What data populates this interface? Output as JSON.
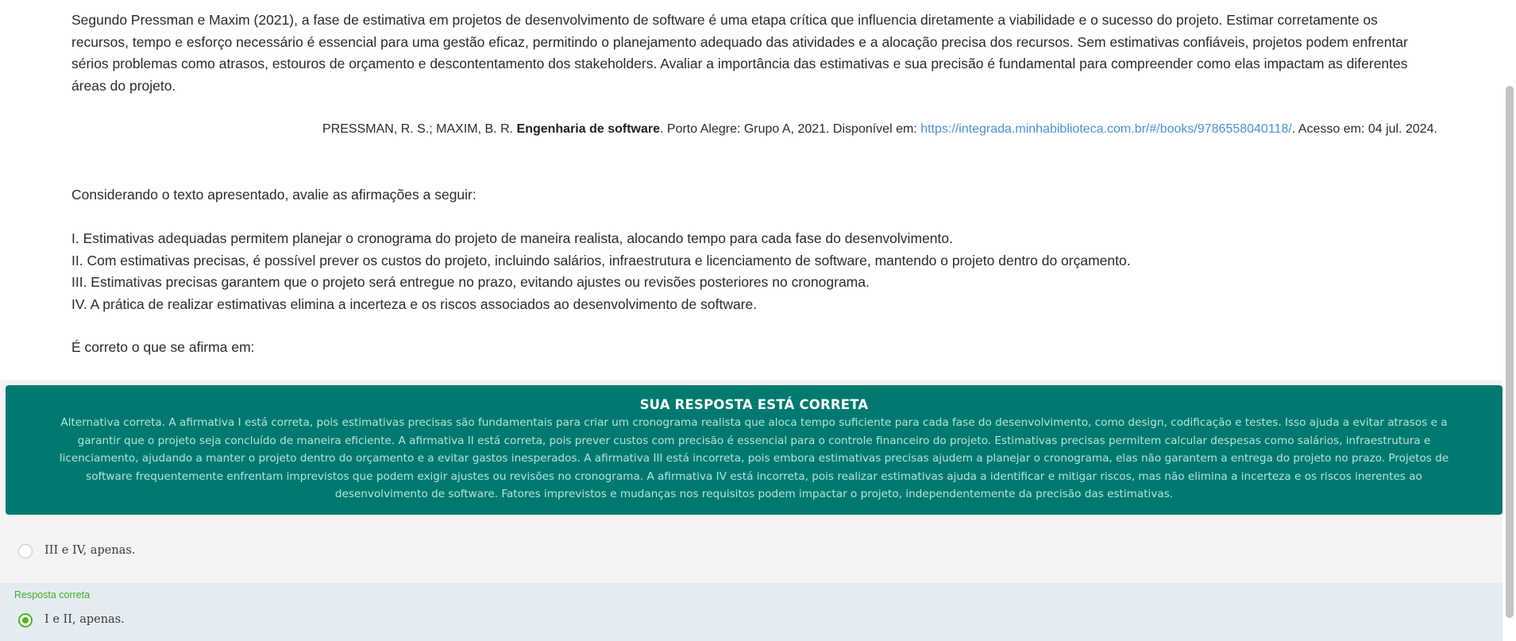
{
  "question": {
    "paragraph": "Segundo Pressman e Maxim (2021), a fase de estimativa em projetos de desenvolvimento de software é uma etapa crítica que influencia diretamente a viabilidade e o sucesso do projeto. Estimar corretamente os recursos, tempo e esforço necessário é essencial para uma gestão eficaz, permitindo o planejamento adequado das atividades e a alocação precisa dos recursos. Sem estimativas confiáveis, projetos podem enfrentar sérios problemas como atrasos, estouros de orçamento e descontentamento dos stakeholders. Avaliar a importância das estimativas e sua precisão é fundamental para compreender como elas impactam as diferentes áreas do projeto.",
    "reference": {
      "authors": "PRESSMAN, R. S.; MAXIM, B. R. ",
      "book_title": "Engenharia de software",
      "publisher": ". Porto Alegre: Grupo A, 2021. Disponível em: ",
      "link": "https://integrada.minhabiblioteca.com.br/#/books/9786558040118/",
      "access": ". Acesso em: 04 jul. 2024."
    },
    "consider": "Considerando o texto apresentado, avalie as afirmações a seguir:",
    "statements": [
      "I. Estimativas adequadas permitem planejar o cronograma do projeto de maneira realista, alocando tempo para cada fase do desenvolvimento.",
      "II. Com estimativas precisas, é possível prever os custos do projeto, incluindo salários, infraestrutura e licenciamento de software, mantendo o projeto dentro do orçamento.",
      "III. Estimativas precisas garantem que o projeto será entregue no prazo, evitando ajustes ou revisões posteriores no cronograma.",
      "IV. A prática de realizar estimativas elimina a incerteza e os riscos associados ao desenvolvimento de software."
    ],
    "prompt": "É correto o que se afirma em:"
  },
  "feedback": {
    "title": "SUA RESPOSTA ESTÁ CORRETA",
    "text": "Alternativa correta. A afirmativa I está correta, pois estimativas precisas são fundamentais para criar um cronograma realista que aloca tempo suficiente para cada fase do desenvolvimento, como design, codificação e testes. Isso ajuda a evitar atrasos e a garantir que o projeto seja concluído de maneira eficiente. A afirmativa II está correta, pois prever custos com precisão é essencial para o controle financeiro do projeto. Estimativas precisas permitem calcular despesas como salários, infraestrutura e licenciamento, ajudando a manter o projeto dentro do orçamento e a evitar gastos inesperados. A afirmativa III está incorreta, pois embora estimativas precisas ajudem a planejar o cronograma, elas não garantem a entrega do projeto no prazo. Projetos de software frequentemente enfrentam imprevistos que podem exigir ajustes ou revisões no cronograma. A afirmativa IV está incorreta, pois realizar estimativas ajuda a identificar e mitigar riscos, mas não elimina a incerteza e os riscos inerentes ao desenvolvimento de software. Fatores imprevistos e mudanças nos requisitos podem impactar o projeto, independentemente da precisão das estimativas.",
    "background_color": "#007a71"
  },
  "options": [
    {
      "label": "III e IV, apenas.",
      "selected": false
    },
    {
      "label": "I e II, apenas.",
      "selected": true,
      "tag": "Resposta correta"
    }
  ],
  "colors": {
    "correct_green": "#4db520",
    "link_blue": "#4a90d9"
  }
}
